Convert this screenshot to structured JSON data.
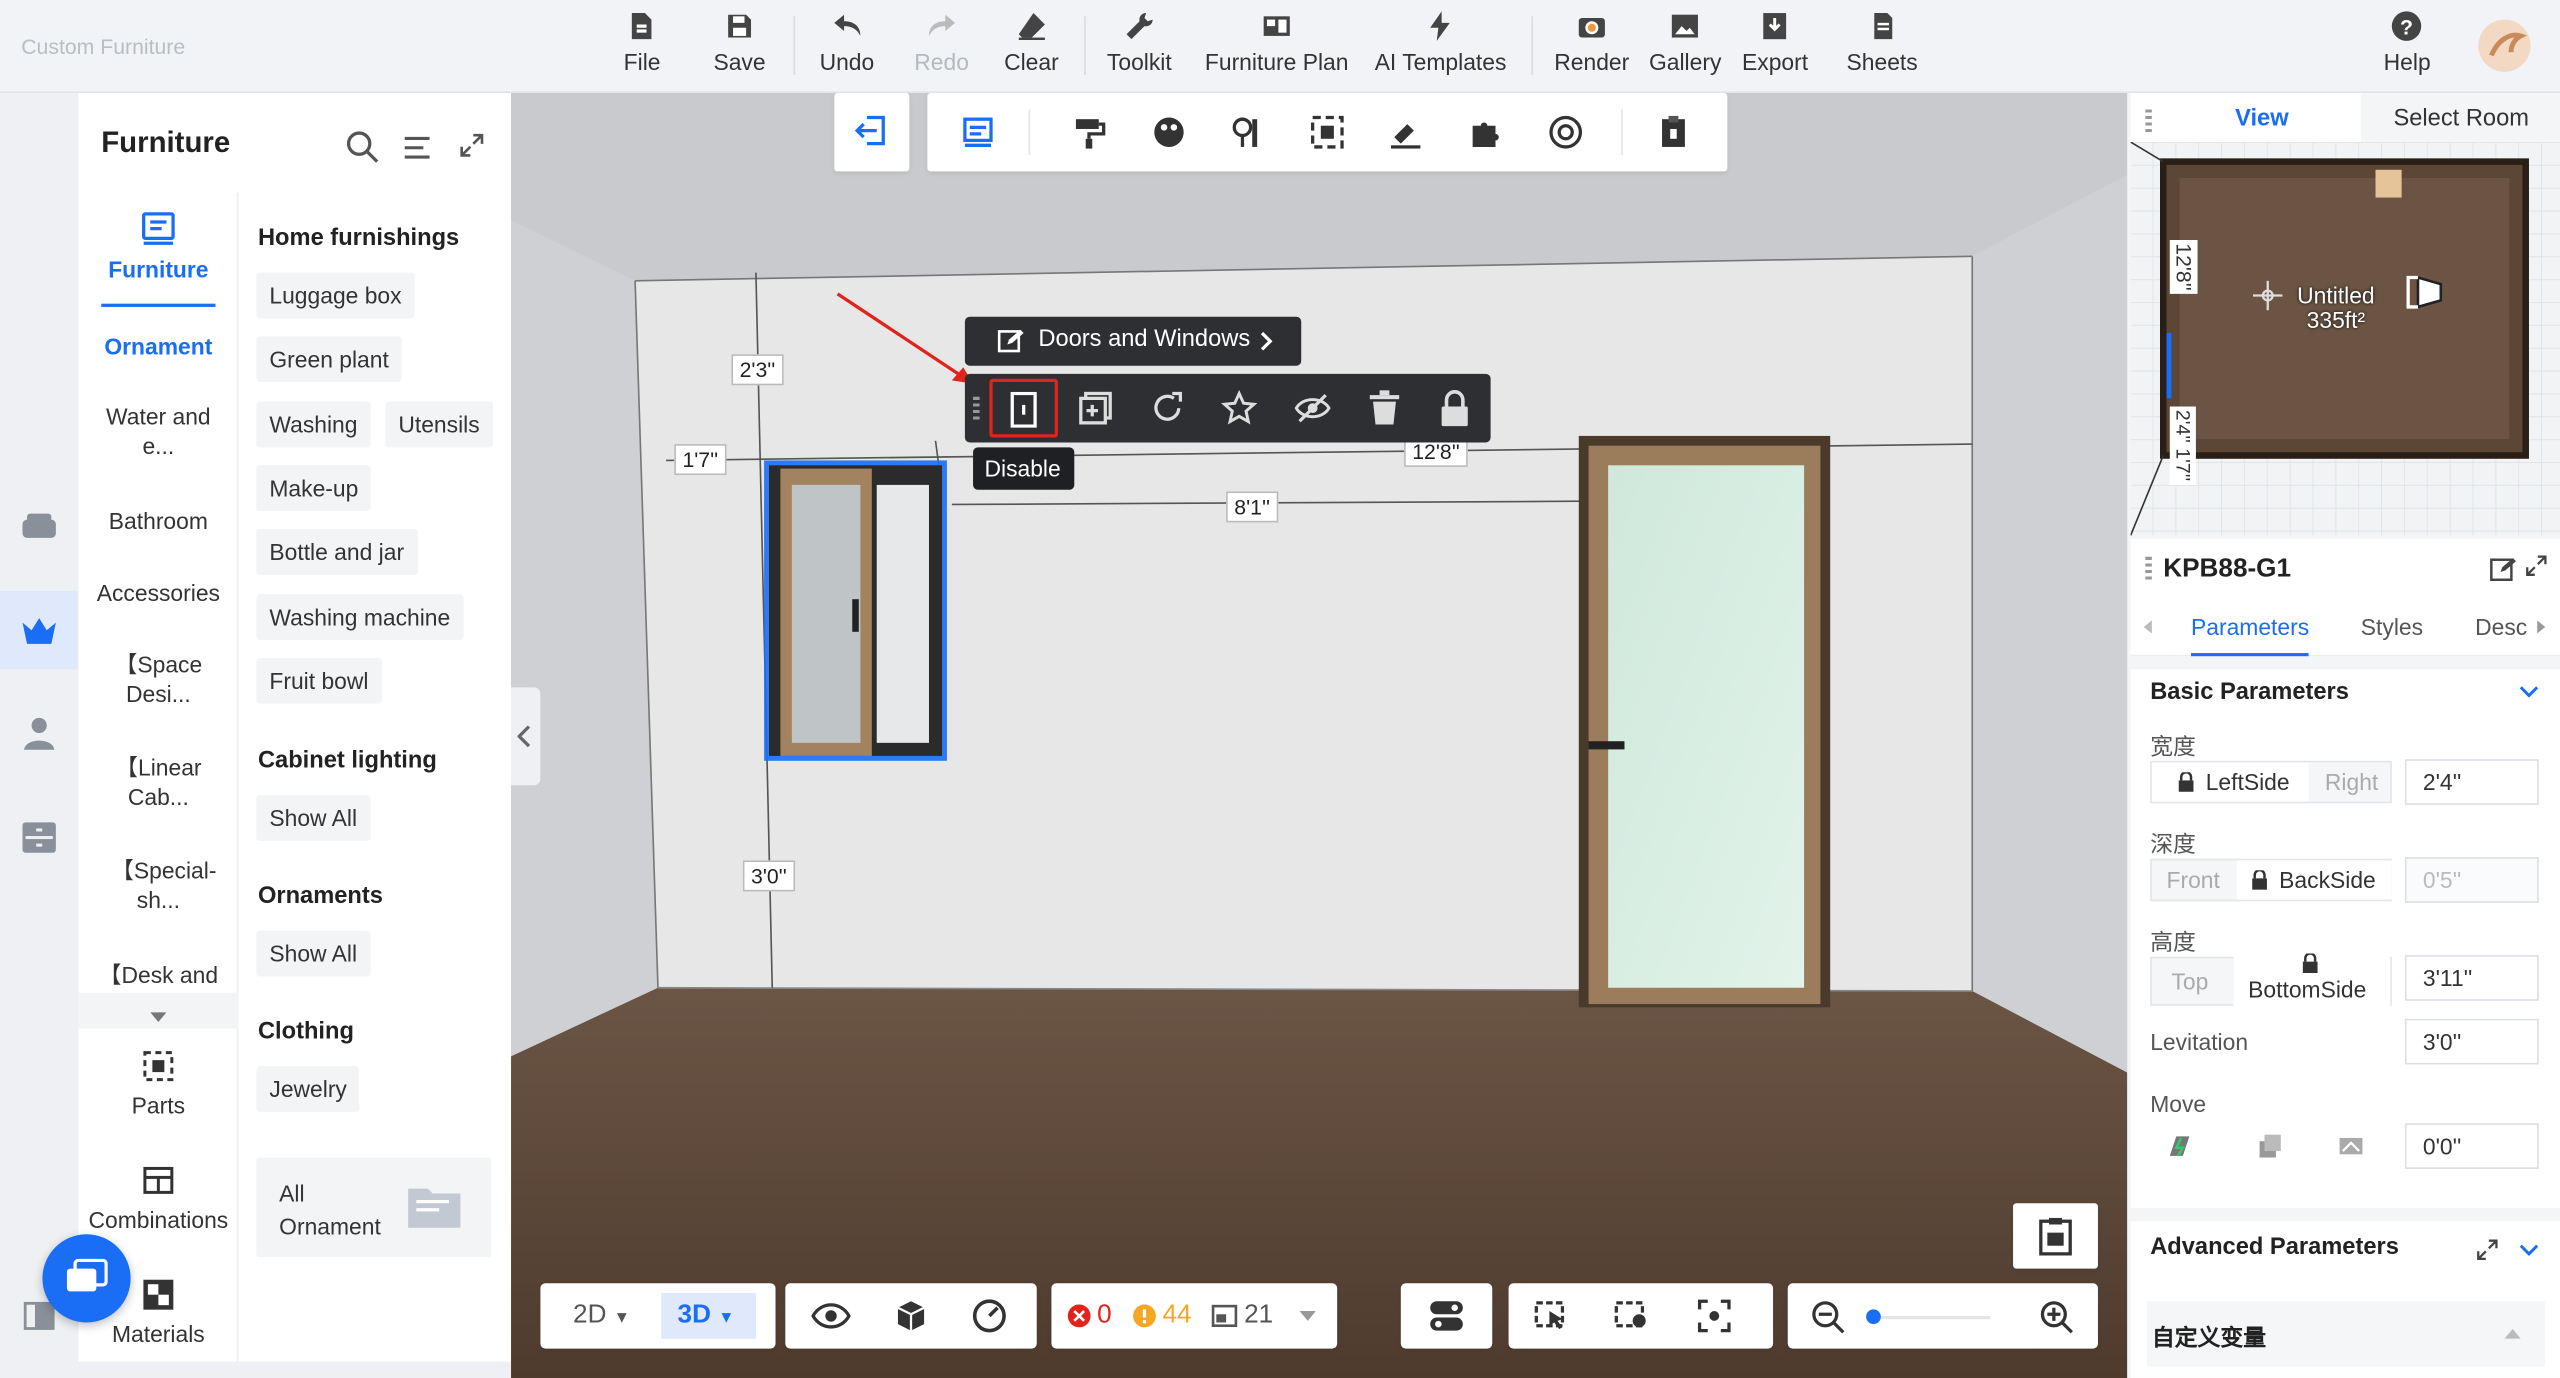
{
  "app": {
    "name": "Custom Furniture"
  },
  "toolbar": {
    "file": "File",
    "save": "Save",
    "undo": "Undo",
    "redo": "Redo",
    "clear": "Clear",
    "toolkit": "Toolkit",
    "furniture_plan": "Furniture Plan",
    "ai_templates": "AI Templates",
    "render": "Render",
    "gallery": "Gallery",
    "export": "Export",
    "sheets": "Sheets",
    "help": "Help"
  },
  "panel": {
    "title": "Furniture",
    "categories": [
      {
        "label": "Furniture"
      },
      {
        "label": "Ornament"
      },
      {
        "label": "Water and e..."
      },
      {
        "label": "Bathroom"
      },
      {
        "label": "Accessories"
      },
      {
        "label": "【Space Desi..."
      },
      {
        "label": "【Linear Cab..."
      },
      {
        "label": "【Special-sh..."
      },
      {
        "label": "【Desk and"
      },
      {
        "label": "Parts"
      },
      {
        "label": "Combinations"
      },
      {
        "label": "Materials"
      }
    ],
    "sections": {
      "home": "Home furnishings",
      "cabinet": "Cabinet lighting",
      "ornaments": "Ornaments",
      "clothing": "Clothing"
    },
    "chips": {
      "luggage": "Luggage box",
      "plant": "Green plant",
      "washing": "Washing",
      "utensils": "Utensils",
      "makeup": "Make-up",
      "bottle": "Bottle and jar",
      "washing_machine": "Washing machine",
      "fruit": "Fruit bowl",
      "show_all_1": "Show All",
      "show_all_2": "Show All",
      "jewelry": "Jewelry"
    },
    "all_ornament_1": "All",
    "all_ornament_2": "Ornament"
  },
  "viewport": {
    "dims": {
      "d1": "2'3''",
      "d2": "1'7''",
      "d3": "8'1''",
      "d4": "12'8''",
      "d5": "3'0''"
    },
    "context": {
      "title": "Doors and Windows",
      "tooltip": "Disable"
    },
    "bottom": {
      "mode2d": "2D",
      "mode3d": "3D",
      "errors": "0",
      "warnings": "44",
      "count": "21"
    }
  },
  "right": {
    "tabs": {
      "view": "View",
      "select_room": "Select Room"
    },
    "minimap": {
      "room_name": "Untitled",
      "room_area": "335ft²",
      "dim_top": "12'8''",
      "dim_side": "2'4'' 1'7''"
    },
    "model": "KPB88-G1",
    "ptabs": {
      "parameters": "Parameters",
      "styles": "Styles",
      "desc": "Desc"
    },
    "basic": "Basic Parameters",
    "width_label": "宽度",
    "left_side": "LeftSide",
    "right": "Right",
    "width_val": "2'4''",
    "depth_label": "深度",
    "front": "Front",
    "back_side": "BackSide",
    "depth_val": "0'5''",
    "height_label": "高度",
    "top": "Top",
    "bottom_side": "BottomSide",
    "height_val": "3'11''",
    "levitation": "Levitation",
    "levitation_val": "3'0''",
    "move": "Move",
    "move_val": "0'0''",
    "advanced": "Advanced Parameters",
    "custom_vars": "自定义变量"
  },
  "colors": {
    "accent": "#1a6ef5",
    "highlight": "#e0231b",
    "ctx_bg": "#2d2f33"
  }
}
